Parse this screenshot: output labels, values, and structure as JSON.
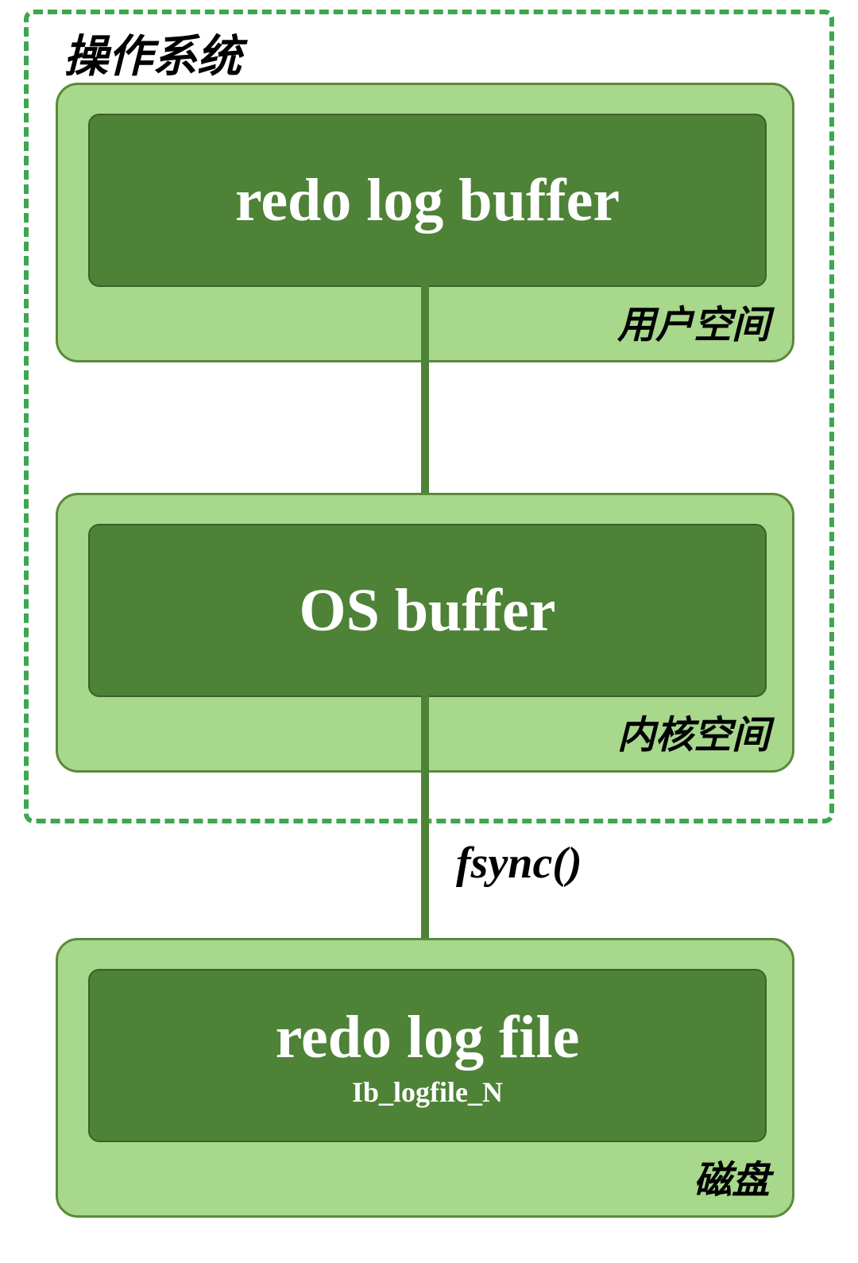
{
  "os_title": "操作系统",
  "box1": {
    "inner_title": "redo log buffer",
    "label": "用户空间"
  },
  "box2": {
    "inner_title": "OS buffer",
    "label": "内核空间"
  },
  "box3": {
    "inner_title": "redo log file",
    "inner_subtitle": "Ib_logfile_N",
    "label": "磁盘"
  },
  "arrow2_label": "fsync()"
}
